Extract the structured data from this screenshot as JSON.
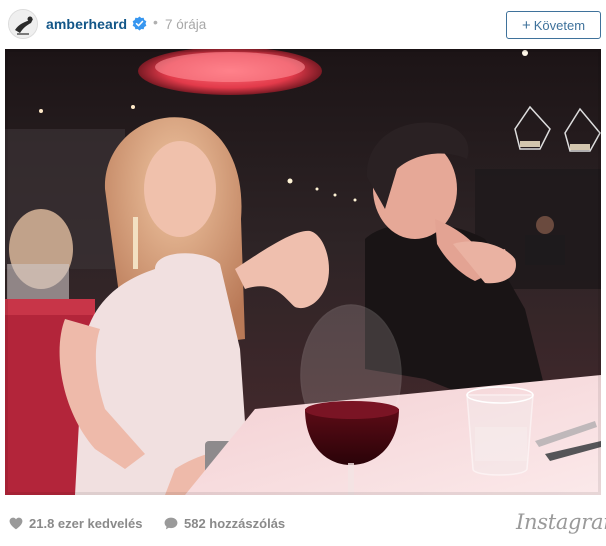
{
  "post": {
    "username": "amberheard",
    "verified_icon": "verified-badge-icon",
    "separator": "•",
    "time": "7 órája",
    "follow_label": "Követem",
    "follow_icon": "plus-icon",
    "accent_color": "#3f729b",
    "username_color": "#125688"
  },
  "photo": {
    "description_icon": "photo-image"
  },
  "footer": {
    "likes_icon": "heart-icon",
    "likes": "21.8 ezer kedvelés",
    "comments_icon": "comment-bubble-icon",
    "comments": "582 hozzászólás",
    "brand": "Instagram"
  }
}
